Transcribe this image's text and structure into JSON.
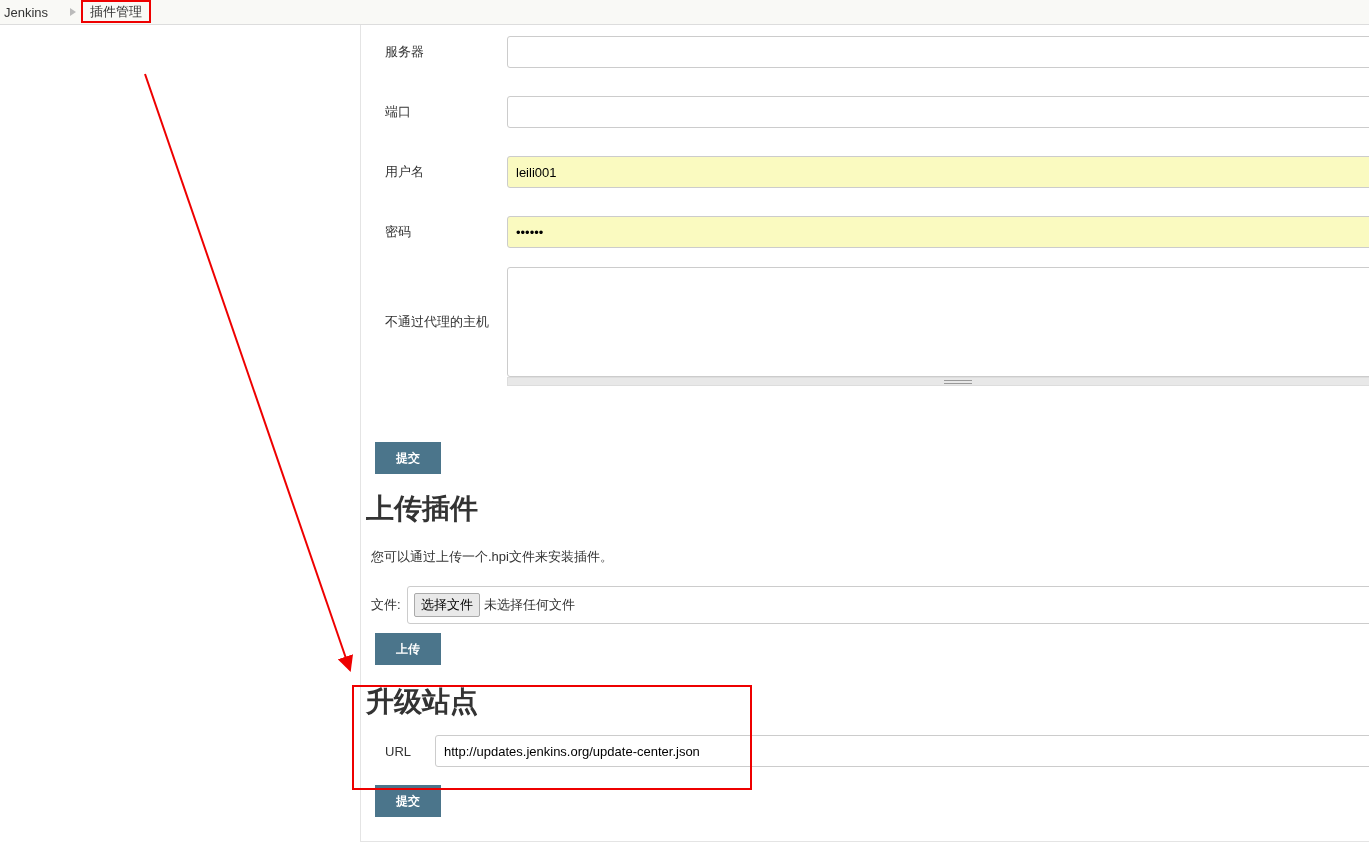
{
  "breadcrumb": [
    {
      "label": "Jenkins"
    },
    {
      "label": "插件管理"
    }
  ],
  "proxy_form": {
    "fields": [
      {
        "kind": "input",
        "label": "服务器",
        "autofill": false
      },
      {
        "kind": "input",
        "label": "端口",
        "autofill": false
      },
      {
        "kind": "input",
        "label": "用户名",
        "value": "leili001",
        "autofill": true
      },
      {
        "kind": "input",
        "label": "密码",
        "value": "••••••",
        "autofill": true
      },
      {
        "kind": "textarea",
        "label": "不通过代理的主机",
        "autofill": false
      }
    ],
    "submit": "提交"
  },
  "upload": {
    "title": "上传插件",
    "description": "您可以通过上传一个.hpi文件来安装插件。",
    "file_label": "文件:",
    "choose_button": "选择文件",
    "file_status": "未选择任何文件",
    "submit": "上传"
  },
  "update_site": {
    "title": "升级站点",
    "url_label": "URL",
    "url": "http://updates.jenkins.org/update-center.json",
    "submit": "提交"
  }
}
